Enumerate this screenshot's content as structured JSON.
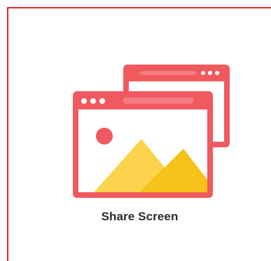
{
  "tile": {
    "label": "Share Screen",
    "icon": "share-screen-icon"
  },
  "colors": {
    "border": "#e2262a",
    "window": "#f05a5f",
    "window_bar_accent": "#f47c80",
    "mountain_light": "#fcd34d",
    "mountain_dark": "#f6c21a",
    "sun": "#f05a5f",
    "label_text": "#2b2b2b"
  }
}
